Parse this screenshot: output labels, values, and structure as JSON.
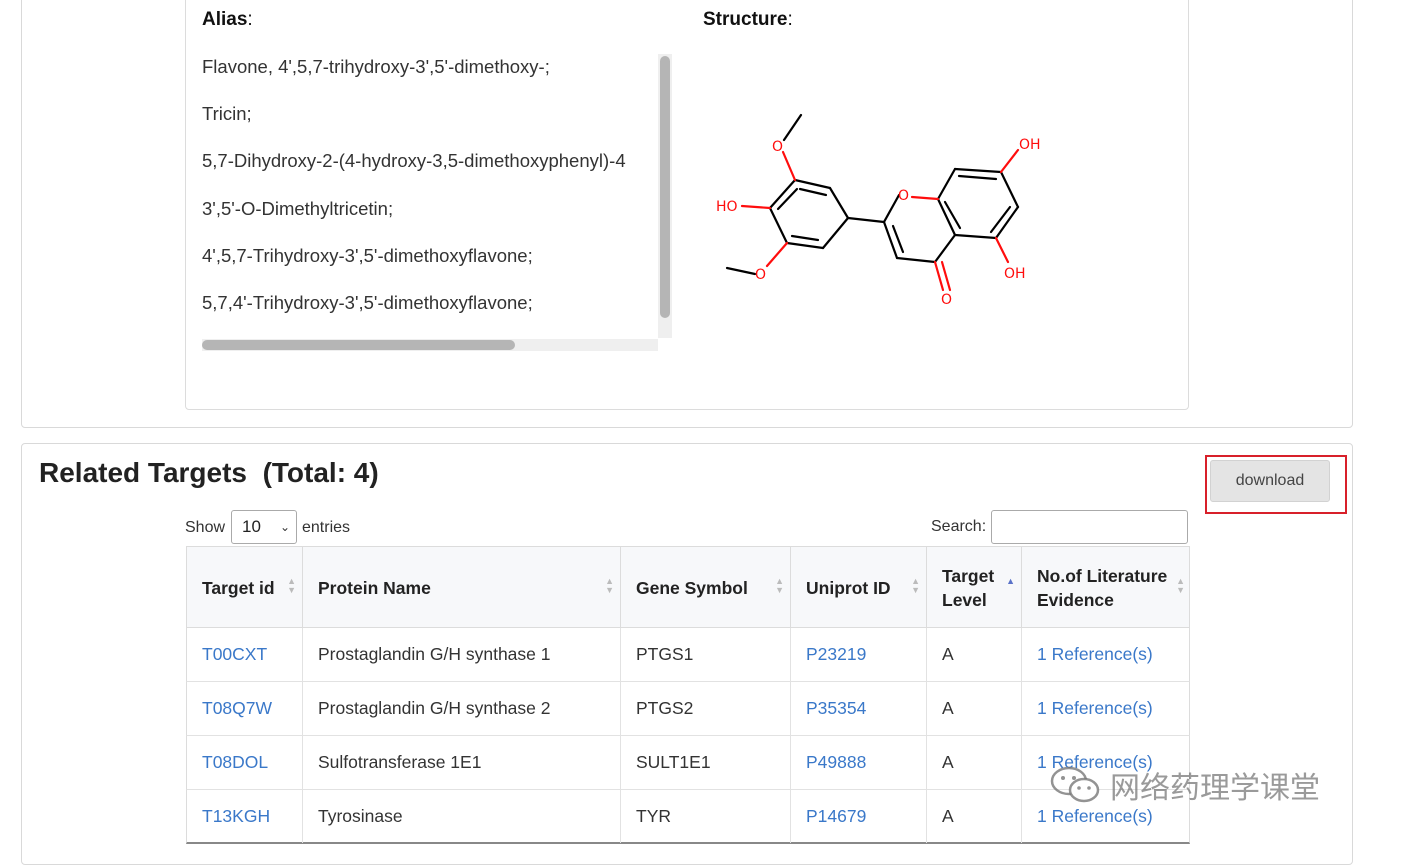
{
  "compound": {
    "alias_label": "Alias",
    "structure_label": "Structure",
    "aliases": [
      "Flavone, 4',5,7-trihydroxy-3',5'-dimethoxy-;",
      "Tricin;",
      "5,7-Dihydroxy-2-(4-hydroxy-3,5-dimethoxyphenyl)-4",
      "3',5'-O-Dimethyltricetin;",
      "4',5,7-Trihydroxy-3',5'-dimethoxyflavone;",
      "5,7,4'-Trihydroxy-3',5'-dimethoxyflavone;"
    ],
    "atom_labels": {
      "oh_top": "OH",
      "oh_bottom": "OH",
      "ho_left": "HO",
      "o": "O"
    },
    "colors": {
      "bond": "#000000",
      "heteroatom": "#ff0d0d"
    }
  },
  "targets": {
    "title": "Related Targets",
    "total": "(Total: 4)",
    "download_label": "download",
    "show_label": "Show",
    "entries_label": "entries",
    "page_length": "10",
    "search_label": "Search:",
    "search_value": "",
    "columns": [
      {
        "label": "Target id"
      },
      {
        "label": "Protein Name"
      },
      {
        "label": "Gene Symbol"
      },
      {
        "label": "Uniprot ID"
      },
      {
        "label": "Target Level"
      },
      {
        "label": "No.of Literature Evidence"
      }
    ],
    "sorted_column": "Target Level",
    "rows": [
      {
        "target_id": "T00CXT",
        "protein": "Prostaglandin G/H synthase 1",
        "gene": "PTGS1",
        "uniprot": "P23219",
        "level": "A",
        "evidence": "1 Reference(s)"
      },
      {
        "target_id": "T08Q7W",
        "protein": "Prostaglandin G/H synthase 2",
        "gene": "PTGS2",
        "uniprot": "P35354",
        "level": "A",
        "evidence": "1 Reference(s)"
      },
      {
        "target_id": "T08DOL",
        "protein": "Sulfotransferase 1E1",
        "gene": "SULT1E1",
        "uniprot": "P49888",
        "level": "A",
        "evidence": "1 Reference(s)"
      },
      {
        "target_id": "T13KGH",
        "protein": "Tyrosinase",
        "gene": "TYR",
        "uniprot": "P14679",
        "level": "A",
        "evidence": "1 Reference(s)"
      }
    ],
    "colors": {
      "link": "#3a78c9",
      "highlight_border": "#d8202a"
    }
  },
  "watermark": {
    "text": "网络药理学课堂"
  }
}
